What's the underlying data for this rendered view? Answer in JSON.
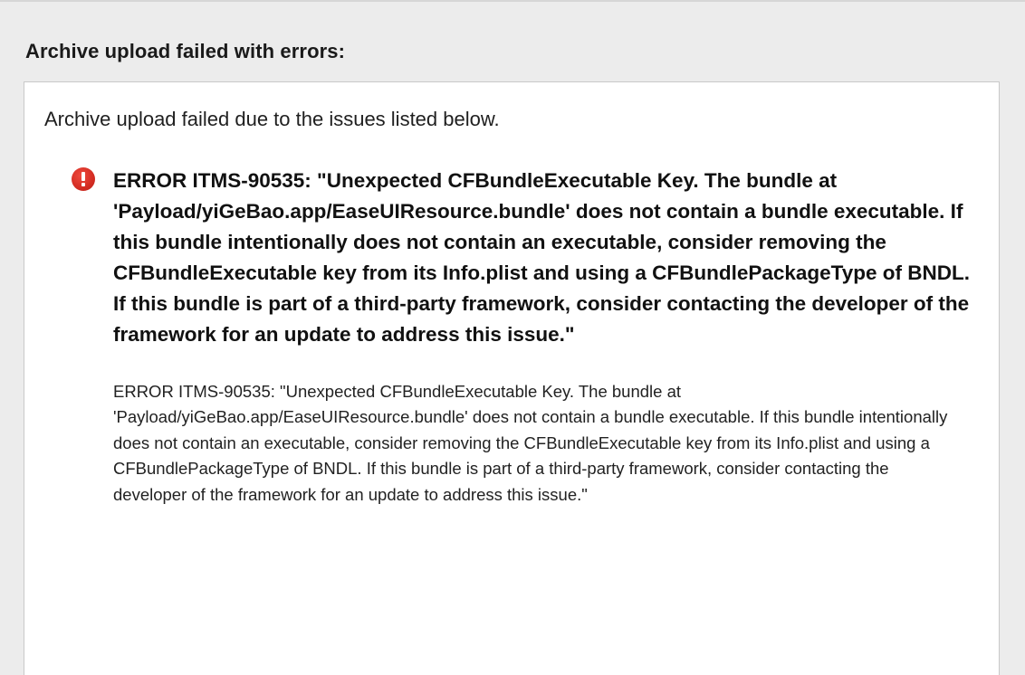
{
  "dialog": {
    "header": "Archive upload failed with errors:",
    "summary": "Archive upload failed due to the issues listed below.",
    "issues": [
      {
        "icon": "error-icon",
        "title": "ERROR ITMS-90535: \"Unexpected CFBundleExecutable Key. The bundle at 'Payload/yiGeBao.app/EaseUIResource.bundle' does not contain a bundle executable. If this bundle intentionally does not contain an executable, consider removing the CFBundleExecutable key from its Info.plist and using a CFBundlePackageType of BNDL. If this bundle is part of a third-party framework, consider contacting the developer of the framework for an update to address this issue.\"",
        "detail": "ERROR ITMS-90535: \"Unexpected CFBundleExecutable Key. The bundle at 'Payload/yiGeBao.app/EaseUIResource.bundle' does not contain a bundle executable. If this bundle intentionally does not contain an executable, consider removing the CFBundleExecutable key from its Info.plist and using a CFBundlePackageType of BNDL. If this bundle is part of a third-party framework, consider contacting the developer of the framework for an update to address this issue.\""
      }
    ]
  },
  "colors": {
    "background": "#ececec",
    "panel": "#ffffff",
    "error": "#d93025"
  }
}
